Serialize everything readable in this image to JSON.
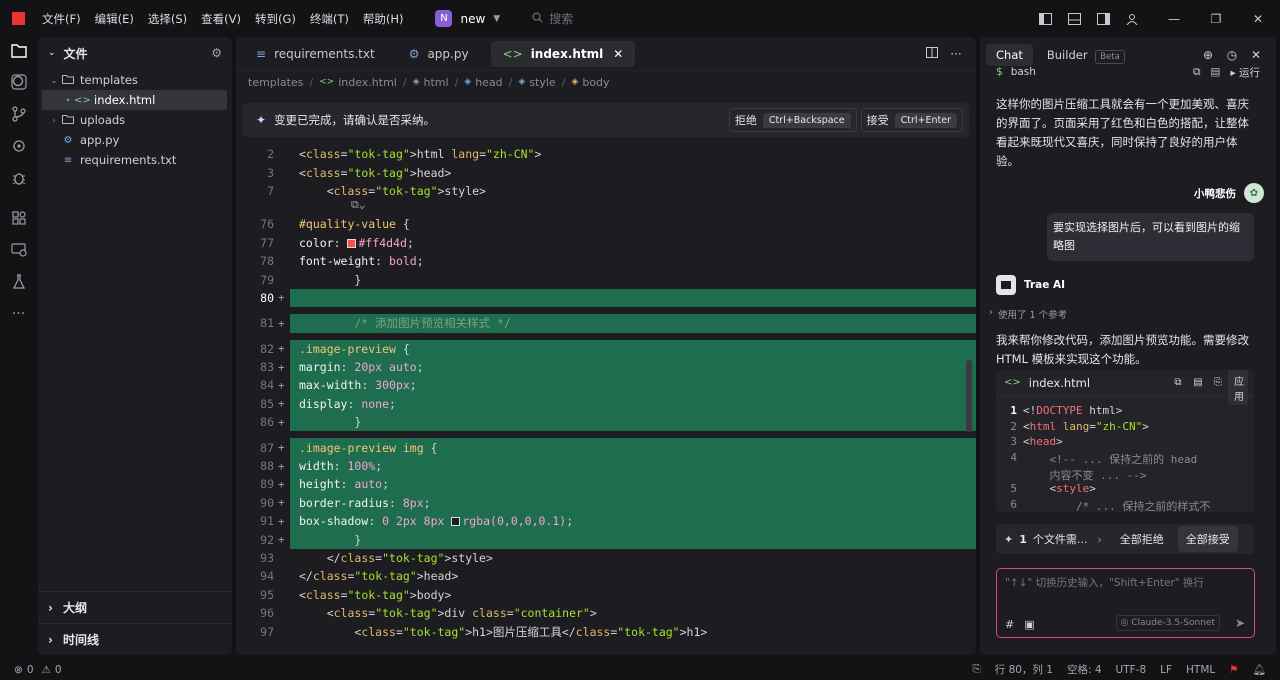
{
  "titlebar": {
    "menu": [
      "文件(F)",
      "编辑(E)",
      "选择(S)",
      "查看(V)",
      "转到(G)",
      "终端(T)",
      "帮助(H)"
    ],
    "project_badge": "N",
    "project_name": "new",
    "search_placeholder": "搜索",
    "accent": "#e8352f"
  },
  "activity_icons": [
    "files-icon",
    "search-icon",
    "source-control-icon",
    "remote-icon",
    "debug-icon",
    "extensions-icon",
    "remote-explorer-icon",
    "testing-icon",
    "more-icon"
  ],
  "explorer": {
    "title": "文件",
    "items": [
      {
        "label": "templates",
        "type": "folder",
        "expanded": true,
        "depth": 0
      },
      {
        "label": "index.html",
        "type": "html",
        "depth": 1,
        "selected": true
      },
      {
        "label": "uploads",
        "type": "folder",
        "expanded": false,
        "depth": 0
      },
      {
        "label": "app.py",
        "type": "python",
        "depth": 0
      },
      {
        "label": "requirements.txt",
        "type": "text",
        "depth": 0
      }
    ],
    "outline": "大纲",
    "timeline": "时间线"
  },
  "editor": {
    "tabs": [
      {
        "label": "requirements.txt",
        "active": false,
        "icon": "text-file-icon"
      },
      {
        "label": "app.py",
        "active": false,
        "icon": "python-icon"
      },
      {
        "label": "index.html",
        "active": true,
        "icon": "html-icon"
      }
    ],
    "close_glyph": "✕",
    "breadcrumb": [
      "templates",
      "index.html",
      "html",
      "head",
      "style",
      "body"
    ],
    "notice": {
      "text": "变更已完成，请确认是否采纳。",
      "reject_label": "拒绝",
      "reject_key": "Ctrl+Backspace",
      "accept_label": "接受",
      "accept_key": "Ctrl+Enter"
    },
    "sticky_lines": [
      {
        "n": "2",
        "code": "<html lang=\"zh-CN\">"
      },
      {
        "n": "3",
        "code": "<head>"
      },
      {
        "n": "7",
        "code": "    <style>"
      }
    ],
    "lines": [
      {
        "n": "76",
        "code": "        #quality-value {",
        "added": false
      },
      {
        "n": "77",
        "code": "            color: #ff4d4d;",
        "added": false,
        "swatch": "#ff4d4d"
      },
      {
        "n": "78",
        "code": "            font-weight: bold;",
        "added": false
      },
      {
        "n": "79",
        "code": "        }",
        "added": false
      },
      {
        "n": "80",
        "code": "",
        "added": true,
        "current": true
      },
      {
        "n": "81",
        "code": "        /* 添加图片预览相关样式 */",
        "added": true
      },
      {
        "n": "82",
        "code": "        .image-preview {",
        "added": true
      },
      {
        "n": "83",
        "code": "            margin: 20px auto;",
        "added": true
      },
      {
        "n": "84",
        "code": "            max-width: 300px;",
        "added": true
      },
      {
        "n": "85",
        "code": "            display: none;",
        "added": true
      },
      {
        "n": "86",
        "code": "        }",
        "added": true
      },
      {
        "n": "87",
        "code": "        .image-preview img {",
        "added": true
      },
      {
        "n": "88",
        "code": "            width: 100%;",
        "added": true
      },
      {
        "n": "89",
        "code": "            height: auto;",
        "added": true
      },
      {
        "n": "90",
        "code": "            border-radius: 8px;",
        "added": true
      },
      {
        "n": "91",
        "code": "            box-shadow: 0 2px 8px rgba(0,0,0,0.1);",
        "added": true,
        "swatch": "#1c1c21"
      },
      {
        "n": "92",
        "code": "        }",
        "added": true
      },
      {
        "n": "93",
        "code": "    </style>",
        "added": false
      },
      {
        "n": "94",
        "code": "</head>",
        "added": false
      },
      {
        "n": "95",
        "code": "<body>",
        "added": false
      },
      {
        "n": "96",
        "code": "    <div class=\"container\">",
        "added": false
      },
      {
        "n": "97",
        "code": "        <h1>图片压缩工具</h1>",
        "added": false
      }
    ],
    "add_color": "#1f6d4f"
  },
  "chat": {
    "tabs": [
      "Chat",
      "Builder"
    ],
    "beta": "Beta",
    "top_snippet": "bash",
    "top_run": "运行",
    "assistant_msg_1": "这样你的图片压缩工具就会有一个更加美观、喜庆的界面了。页面采用了红色和白色的搭配，让整体看起来既现代又喜庆，同时保持了良好的用户体验。",
    "user_name": "小鸭悲伤",
    "user_msg": "要实现选择图片后，可以看到图片的缩略图",
    "ai_name": "Trae AI",
    "ref_text": "使用了 1 个参考",
    "assistant_msg_2": "我来帮你修改代码，添加图片预览功能。需要修改 HTML 模板来实现这个功能。",
    "code_card": {
      "filename": "index.html",
      "apply_label": "应用",
      "lines": [
        {
          "n": "1",
          "code": "<!DOCTYPE html>"
        },
        {
          "n": "2",
          "code": "<html lang=\"zh-CN\">"
        },
        {
          "n": "3",
          "code": "<head>"
        },
        {
          "n": "4",
          "code": "    <!-- ... 保持之前的 head"
        },
        {
          "n": "",
          "code": "    内容不变 ... -->"
        },
        {
          "n": "5",
          "code": "    <style>"
        },
        {
          "n": "6",
          "code": "        /* ... 保持之前的样式不"
        }
      ]
    },
    "pending": {
      "count": "1",
      "text": "个文件需...",
      "reject_all": "全部拒绝",
      "accept_all": "全部接受"
    },
    "input_placeholder": "\"↑↓\" 切换历史输入，\"Shift+Enter\" 换行",
    "model": "Claude-3.5-Sonnet",
    "input_border": "#d44d6e"
  },
  "status": {
    "errors": "0",
    "warnings": "0",
    "position": "行 80，列 1",
    "spaces": "空格: 4",
    "encoding": "UTF-8",
    "eol": "LF",
    "language": "HTML"
  }
}
